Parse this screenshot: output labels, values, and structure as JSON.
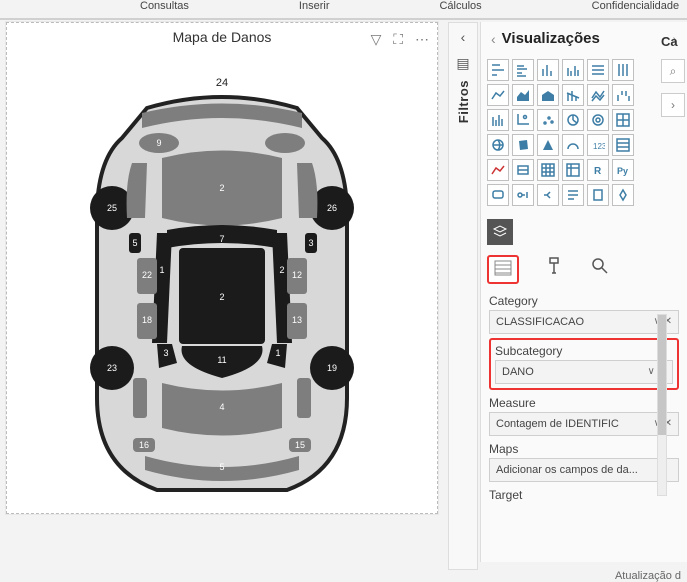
{
  "ribbon": {
    "tabs": [
      "Consultas",
      "Inserir",
      "Cálculos",
      "Confidencialidade"
    ]
  },
  "visual": {
    "title": "Mapa de Danos",
    "label_top": "24",
    "parts": [
      24,
      2,
      9,
      25,
      26,
      4,
      5,
      3,
      22,
      1,
      7,
      2,
      12,
      18,
      3,
      2,
      11,
      13,
      23,
      4,
      19,
      5,
      16,
      15
    ]
  },
  "filters": {
    "label": "Filtros"
  },
  "viz": {
    "title": "Visualizações",
    "sidecut_label": "Ca",
    "gallery": [
      "stacked-bar",
      "clustered-bar",
      "stacked-col",
      "clustered-col",
      "100-bar",
      "100-col",
      "line",
      "area",
      "stacked-area",
      "line-col",
      "line-stack",
      "ribbon",
      "waterfall",
      "funnel",
      "scatter",
      "pie",
      "donut",
      "treemap",
      "map",
      "filled-map",
      "azure-map",
      "gauge",
      "card",
      "multi-card",
      "kpi",
      "slicer",
      "table",
      "matrix",
      "r",
      "python",
      "q-and-a",
      "key-infl",
      "decomp",
      "smart-narr",
      "paginated",
      "custom"
    ],
    "fields": {
      "category_label": "Category",
      "category_val": "CLASSIFICACAO",
      "subcategory_label": "Subcategory",
      "subcategory_val": "DANO",
      "measure_label": "Measure",
      "measure_val": "Contagem de IDENTIFIC",
      "maps_label": "Maps",
      "maps_val": "Adicionar os campos de da...",
      "target_label": "Target"
    }
  },
  "footer": "Atualização d"
}
